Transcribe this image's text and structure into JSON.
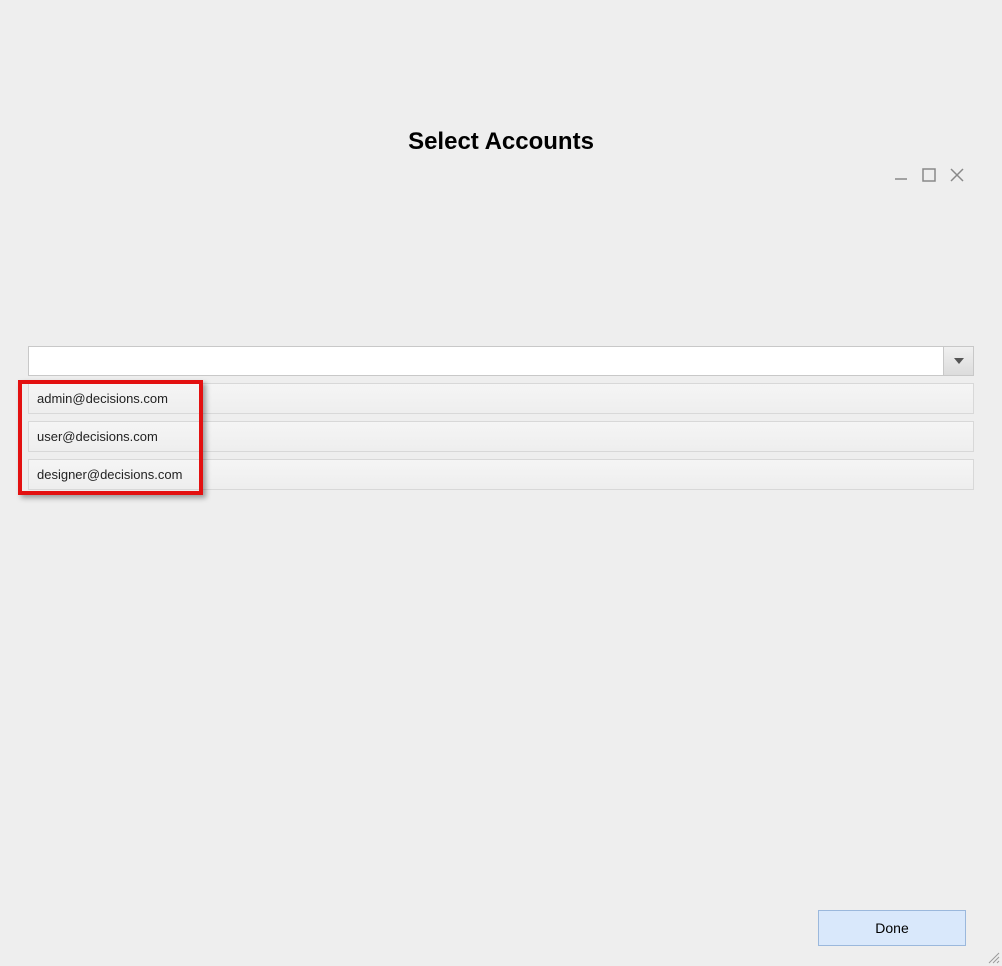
{
  "header": {
    "title": "Select Accounts"
  },
  "dropdown": {
    "value": "",
    "options": [
      "admin@decisions.com",
      "user@decisions.com",
      "designer@decisions.com"
    ]
  },
  "list_items": [
    "admin@decisions.com",
    "user@decisions.com",
    "designer@decisions.com"
  ],
  "buttons": {
    "done": "Done"
  }
}
